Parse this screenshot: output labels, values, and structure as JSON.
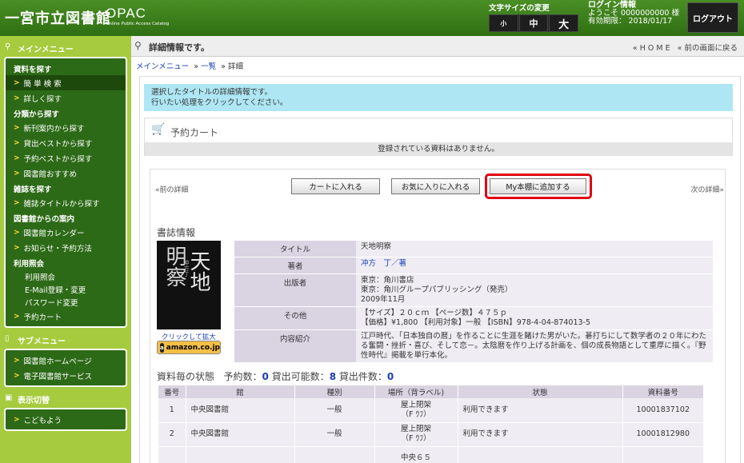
{
  "header": {
    "logo": "一宮市立図書館",
    "opac": "OPAC",
    "opac_sub": "Online Public Access Catalog",
    "font_size_label": "文字サイズの変更",
    "font_small": "小",
    "font_medium": "中",
    "font_large": "大",
    "login_title": "ログイン情報",
    "welcome": "ようこそ 0000000000 様",
    "expiry": "有効期限： 2018/01/17",
    "logout": "ログアウト"
  },
  "sidebar": {
    "main_menu_title": "メインメニュー",
    "cats": {
      "search": "資料を探す",
      "category": "分類から探す",
      "magazine": "雑誌を探す",
      "notice": "図書館からの案内",
      "usage": "利用照会"
    },
    "items": {
      "simple": "簡 単 検 索",
      "detail": "詳しく探す",
      "newarr": "新刊案内から探す",
      "lend_best": "貸出ベストから探す",
      "reserve_best": "予約ベストから探す",
      "recommend": "図書館おすすめ",
      "mag_title": "雑誌タイトルから探す",
      "calendar": "図書館カレンダー",
      "news": "お知らせ・予約方法",
      "usage_inq": "利用照会",
      "email": "E-Mail登録・変更",
      "password": "パスワード変更",
      "cart": "予約カート"
    },
    "sub_menu_title": "サブメニュー",
    "sub_items": {
      "home": "図書館ホームページ",
      "ebook": "電子図書館サービス"
    },
    "display_title": "表示切替",
    "kids": "こどもよう"
  },
  "main": {
    "page_title": "詳細情報です。",
    "home_link": "« H O M E",
    "back_link": "« 前の画面に戻る",
    "crumb_menu": "メインメニュー",
    "crumb_list": "一覧",
    "crumb_detail": "詳細",
    "crumb_sep": "»",
    "info_line1": "選択したタイトルの詳細情報です。",
    "info_line2": "行いたい処理をクリックしてください。",
    "cart_title": "予約カート",
    "cart_msg": "登録されている資料はありません。",
    "prev": "«前の詳細",
    "next": "次の詳細»",
    "btn_cart": "カートに入れる",
    "btn_fav": "お気に入りに入れる",
    "btn_my": "My本棚に追加する",
    "biblio_title": "書誌情報",
    "cover_title1": "天地",
    "cover_title2": "明察",
    "cover_author": "冲方丁",
    "zoom": "クリックして拡大",
    "amazon": "amazon.co.jp",
    "labels": {
      "title": "タイトル",
      "author": "著者",
      "publisher": "出版者",
      "other": "その他",
      "summary": "内容紹介"
    },
    "values": {
      "title": "天地明察",
      "author": "冲方　丁／著",
      "pub1": "東京：角川書店",
      "pub2": "東京：角川グループパブリッシング（発売）",
      "pub3": "2009年11月",
      "other1": "【サイズ】２０ｃｍ 【ページ数】４７５ｐ",
      "other2": "【価格】¥1,800 【利用対象】一般 【ISBN】978-4-04-874013-5",
      "summary": "江戸時代、「日本独自の暦」を作ることに生涯を賭けた男がいた。碁打ちにして数学者の２０年にわたる奮闘・挫折・喜び、そして恋－。太陰暦を作り上げる計画を、個の成長物語として重厚に描く。『野性時代』掲載を単行本化。"
    },
    "status_label": "資料毎の状態",
    "reserve_label": "予約数：",
    "reserve_count": "0",
    "avail_label": "貸出可能数：",
    "avail_count": "8",
    "lent_label": "貸出件数：",
    "lent_count": "0",
    "table": {
      "headers": [
        "番号",
        "館",
        "種別",
        "場所（背ラベル)",
        "状態",
        "資料番号"
      ],
      "rows": [
        [
          "1",
          "中央図書館",
          "一般",
          "屋上閉架",
          "（F ｳﾌ）",
          "利用できます",
          "10001837102"
        ],
        [
          "2",
          "中央図書館",
          "一般",
          "屋上閉架",
          "（F ｳﾌ）",
          "利用できます",
          "10001812980"
        ],
        [
          "",
          "",
          "",
          "中央６５",
          "",
          "",
          ""
        ]
      ]
    }
  }
}
